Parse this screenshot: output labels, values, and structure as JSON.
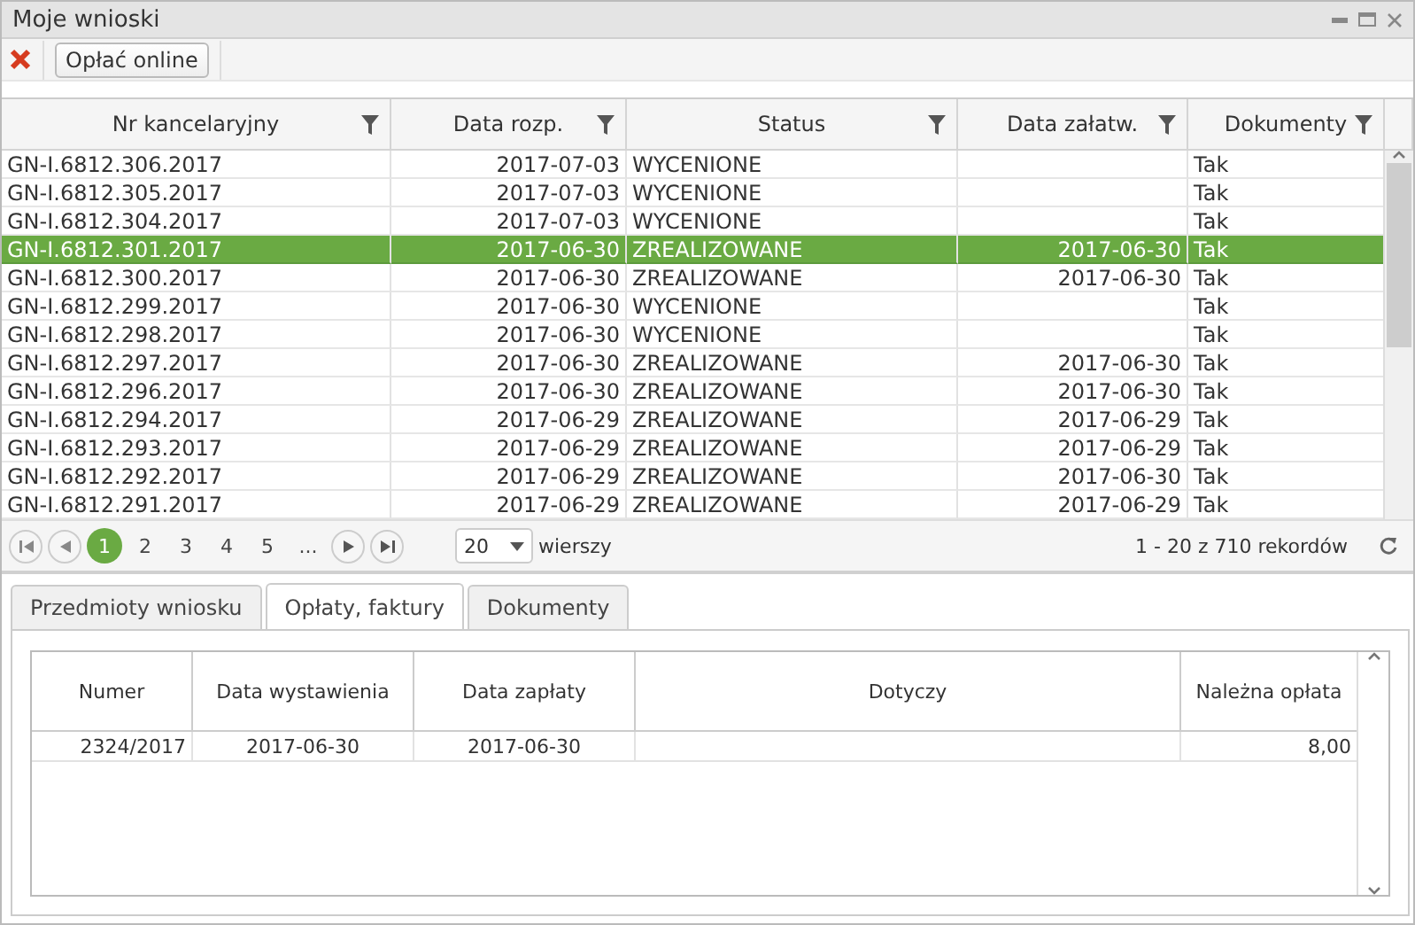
{
  "window": {
    "title": "Moje wnioski"
  },
  "toolbar": {
    "buttons": [
      "Opłać online"
    ]
  },
  "table": {
    "columns": [
      {
        "label": "Nr kancelaryjny",
        "kind": "text"
      },
      {
        "label": "Data rozp.",
        "kind": "date"
      },
      {
        "label": "Status",
        "kind": "text"
      },
      {
        "label": "Data załatw.",
        "kind": "date"
      },
      {
        "label": "Dokumenty",
        "kind": "text"
      }
    ],
    "rows": [
      {
        "cells": [
          "GN-I.6812.306.2017",
          "2017-07-03",
          "WYCENIONE",
          "",
          "Tak"
        ],
        "selected": false
      },
      {
        "cells": [
          "GN-I.6812.305.2017",
          "2017-07-03",
          "WYCENIONE",
          "",
          "Tak"
        ],
        "selected": false
      },
      {
        "cells": [
          "GN-I.6812.304.2017",
          "2017-07-03",
          "WYCENIONE",
          "",
          "Tak"
        ],
        "selected": false
      },
      {
        "cells": [
          "GN-I.6812.301.2017",
          "2017-06-30",
          "ZREALIZOWANE",
          "2017-06-30",
          "Tak"
        ],
        "selected": true
      },
      {
        "cells": [
          "GN-I.6812.300.2017",
          "2017-06-30",
          "ZREALIZOWANE",
          "2017-06-30",
          "Tak"
        ],
        "selected": false
      },
      {
        "cells": [
          "GN-I.6812.299.2017",
          "2017-06-30",
          "WYCENIONE",
          "",
          "Tak"
        ],
        "selected": false
      },
      {
        "cells": [
          "GN-I.6812.298.2017",
          "2017-06-30",
          "WYCENIONE",
          "",
          "Tak"
        ],
        "selected": false
      },
      {
        "cells": [
          "GN-I.6812.297.2017",
          "2017-06-30",
          "ZREALIZOWANE",
          "2017-06-30",
          "Tak"
        ],
        "selected": false
      },
      {
        "cells": [
          "GN-I.6812.296.2017",
          "2017-06-30",
          "ZREALIZOWANE",
          "2017-06-30",
          "Tak"
        ],
        "selected": false
      },
      {
        "cells": [
          "GN-I.6812.294.2017",
          "2017-06-29",
          "ZREALIZOWANE",
          "2017-06-29",
          "Tak"
        ],
        "selected": false
      },
      {
        "cells": [
          "GN-I.6812.293.2017",
          "2017-06-29",
          "ZREALIZOWANE",
          "2017-06-29",
          "Tak"
        ],
        "selected": false
      },
      {
        "cells": [
          "GN-I.6812.292.2017",
          "2017-06-29",
          "ZREALIZOWANE",
          "2017-06-30",
          "Tak"
        ],
        "selected": false
      },
      {
        "cells": [
          "GN-I.6812.291.2017",
          "2017-06-29",
          "ZREALIZOWANE",
          "2017-06-29",
          "Tak"
        ],
        "selected": false
      }
    ]
  },
  "pager": {
    "pages": [
      {
        "label": "1",
        "selected": true
      },
      {
        "label": "2",
        "selected": false
      },
      {
        "label": "3",
        "selected": false
      },
      {
        "label": "4",
        "selected": false
      },
      {
        "label": "5",
        "selected": false
      },
      {
        "label": "...",
        "selected": false
      }
    ],
    "page_size": "20",
    "page_size_label": "wierszy",
    "summary": "1 - 20 z 710 rekordów"
  },
  "tabs": [
    {
      "label": "Przedmioty wniosku",
      "selected": false
    },
    {
      "label": "Opłaty, faktury",
      "selected": true
    },
    {
      "label": "Dokumenty",
      "selected": false
    }
  ],
  "fees_table": {
    "columns": [
      {
        "label": "Numer",
        "kind": "right"
      },
      {
        "label": "Data wystawienia",
        "kind": "center"
      },
      {
        "label": "Data zapłaty",
        "kind": "center"
      },
      {
        "label": "Dotyczy",
        "kind": "left"
      },
      {
        "label": "Należna opłata",
        "kind": "right"
      }
    ],
    "rows": [
      {
        "cells": [
          "2324/2017",
          "2017-06-30",
          "2017-06-30",
          "",
          "8,00"
        ]
      }
    ]
  }
}
